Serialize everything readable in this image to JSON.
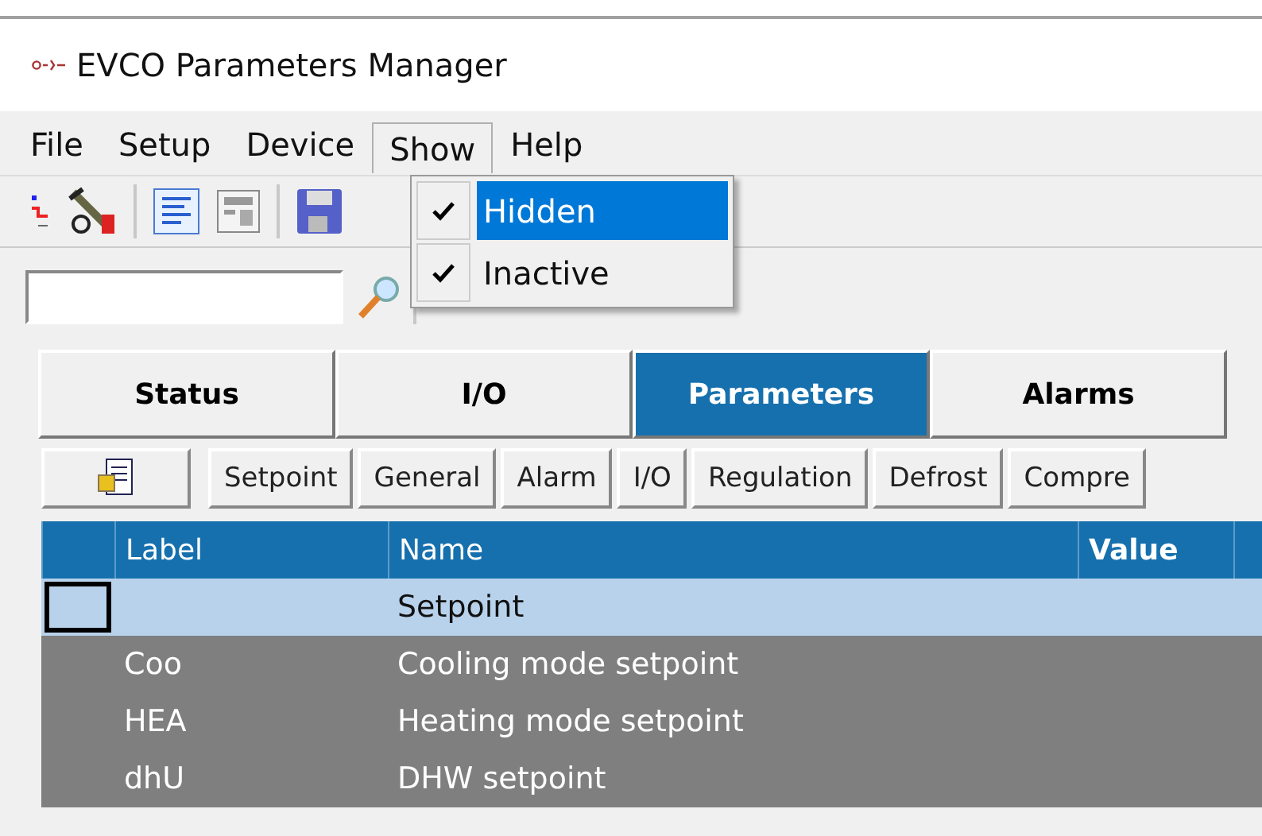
{
  "window": {
    "title": "EVCO Parameters Manager"
  },
  "menu": [
    {
      "label": "File",
      "selected": false
    },
    {
      "label": "Setup",
      "selected": false
    },
    {
      "label": "Device",
      "selected": false
    },
    {
      "label": "Show",
      "selected": true
    },
    {
      "label": "Help",
      "selected": false
    }
  ],
  "show_menu": [
    {
      "label": "Hidden",
      "checked": true,
      "selected": true
    },
    {
      "label": "Inactive",
      "checked": true,
      "selected": false
    }
  ],
  "tabs": [
    {
      "label": "Status",
      "selected": false
    },
    {
      "label": "I/O",
      "selected": false
    },
    {
      "label": "Parameters",
      "selected": true
    },
    {
      "label": "Alarms",
      "selected": false
    }
  ],
  "groups": [
    "Setpoint",
    "General",
    "Alarm",
    "I/O",
    "Regulation",
    "Defrost",
    "Compre"
  ],
  "table": {
    "columns": [
      "Label",
      "Name",
      "Value"
    ],
    "rows": [
      {
        "kind": "group",
        "label": "",
        "name": "Setpoint",
        "selected": true
      },
      {
        "kind": "param",
        "label": "Coo",
        "name": "Cooling mode setpoint",
        "selected": false
      },
      {
        "kind": "param",
        "label": "HEA",
        "name": "Heating mode setpoint",
        "selected": false
      },
      {
        "kind": "param",
        "label": "dhU",
        "name": "DHW setpoint",
        "selected": false
      }
    ]
  }
}
